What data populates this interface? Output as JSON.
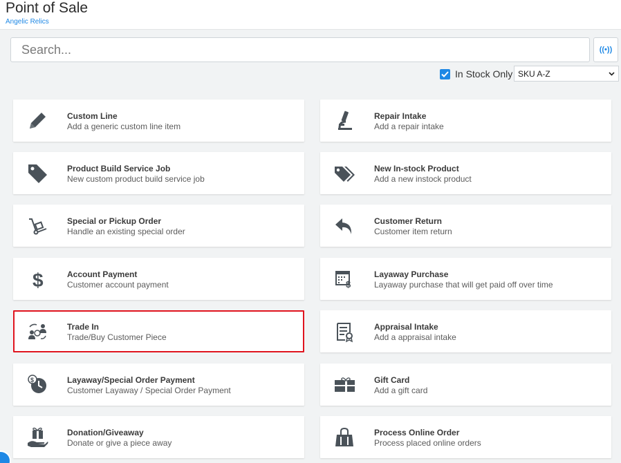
{
  "header": {
    "title": "Point of Sale",
    "store_name": "Angelic Relics"
  },
  "search": {
    "placeholder": "Search...",
    "value": ""
  },
  "scan_button": {
    "label": "((•))"
  },
  "filters": {
    "in_stock_label": "In Stock Only",
    "in_stock_checked": true,
    "sort_value": "SKU A-Z"
  },
  "colors": {
    "accent": "#1e88e5",
    "highlight_border": "#e0141e",
    "icon": "#4a5259"
  },
  "cards": [
    {
      "title": "Custom Line",
      "subtitle": "Add a generic custom line item",
      "icon": "pencil-icon"
    },
    {
      "title": "Repair Intake",
      "subtitle": "Add a repair intake",
      "icon": "microscope-icon"
    },
    {
      "title": "Product Build Service Job",
      "subtitle": "New custom product build service job",
      "icon": "tag-icon"
    },
    {
      "title": "New In-stock Product",
      "subtitle": "Add a new instock product",
      "icon": "tags-icon"
    },
    {
      "title": "Special or Pickup Order",
      "subtitle": "Handle an existing special order",
      "icon": "dolly-icon"
    },
    {
      "title": "Customer Return",
      "subtitle": "Customer item return",
      "icon": "reply-arrow-icon"
    },
    {
      "title": "Account Payment",
      "subtitle": "Customer account payment",
      "icon": "dollar-icon"
    },
    {
      "title": "Layaway Purchase",
      "subtitle": "Layaway purchase that will get paid off over time",
      "icon": "calendar-dollar-icon"
    },
    {
      "title": "Trade In",
      "subtitle": "Trade/Buy Customer Piece",
      "icon": "trade-exchange-icon"
    },
    {
      "title": "Appraisal Intake",
      "subtitle": "Add a appraisal intake",
      "icon": "certificate-icon"
    },
    {
      "title": "Layaway/Special Order Payment",
      "subtitle": "Customer Layaway / Special Order Payment",
      "icon": "clock-dollar-icon"
    },
    {
      "title": "Gift Card",
      "subtitle": "Add a gift card",
      "icon": "gift-card-icon"
    },
    {
      "title": "Donation/Giveaway",
      "subtitle": "Donate or give a piece away",
      "icon": "hand-gift-icon"
    },
    {
      "title": "Process Online Order",
      "subtitle": "Process placed online orders",
      "icon": "shopping-bag-icon"
    }
  ]
}
